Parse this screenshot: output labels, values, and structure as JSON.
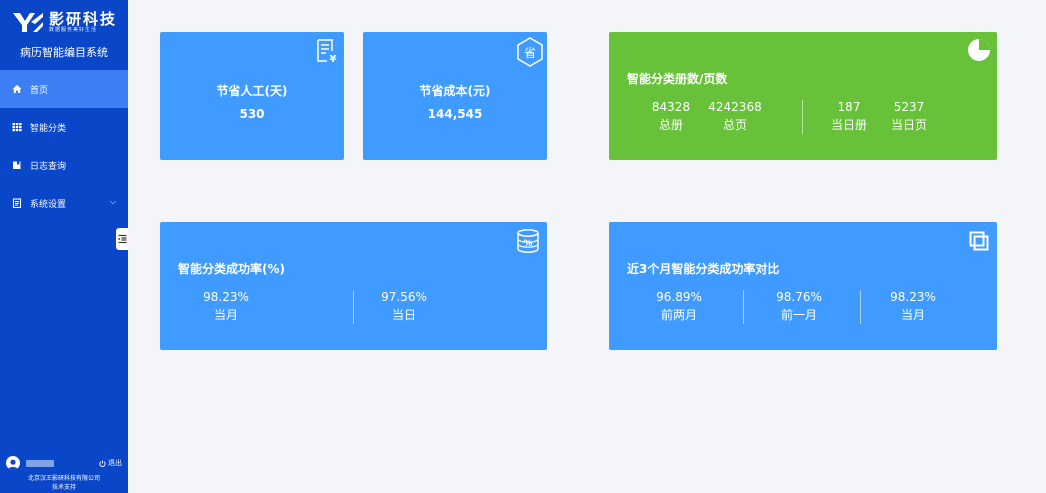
{
  "sidebar": {
    "logo_name": "影研科技",
    "logo_slogan": "数据服务美好生活",
    "system_title": "病历智能编目系统",
    "menu": [
      {
        "label": "首页",
        "icon": "home-icon"
      },
      {
        "label": "智能分类",
        "icon": "grid-icon"
      },
      {
        "label": "日志查询",
        "icon": "book-icon"
      },
      {
        "label": "系统设置",
        "icon": "document-icon"
      }
    ],
    "logout_label": "退出",
    "company": "北京汉王影研科技有限公司",
    "support": "技术支持"
  },
  "cards": {
    "labor": {
      "title": "节省人工(天)",
      "value": "530"
    },
    "cost": {
      "title": "节省成本(元)",
      "value": "144,545",
      "icon_text": "省"
    },
    "volumes": {
      "title": "智能分类册数/页数",
      "stats": [
        {
          "value": "84328",
          "label": "总册"
        },
        {
          "value": "4242368",
          "label": "总页"
        },
        {
          "value": "187",
          "label": "当日册"
        },
        {
          "value": "5237",
          "label": "当日页"
        }
      ]
    },
    "success_rate": {
      "title": "智能分类成功率(%)",
      "stats": [
        {
          "value": "98.23%",
          "label": "当月"
        },
        {
          "value": "97.56%",
          "label": "当日"
        }
      ]
    },
    "three_month": {
      "title": "近3个月智能分类成功率对比",
      "stats": [
        {
          "value": "96.89%",
          "label": "前两月"
        },
        {
          "value": "98.76%",
          "label": "前一月"
        },
        {
          "value": "98.23%",
          "label": "当月"
        }
      ]
    }
  },
  "colors": {
    "sidebar": "#0a46c8",
    "active": "#3d7ef5",
    "card_blue": "#3f9bff",
    "card_green": "#67c23a",
    "background": "#f4f5f9"
  }
}
